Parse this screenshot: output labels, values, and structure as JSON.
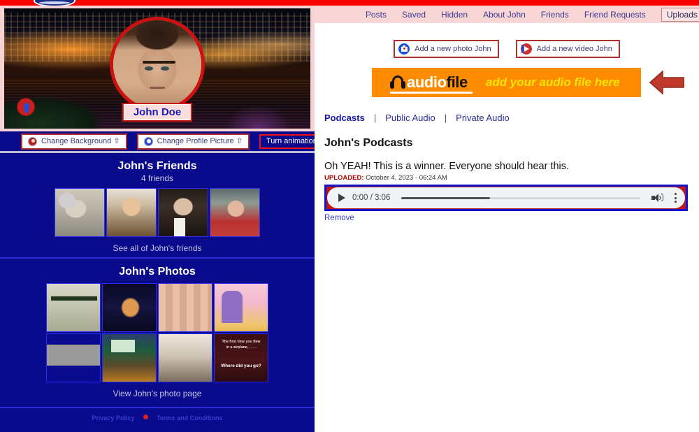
{
  "site": {
    "logo_name": "site-logo"
  },
  "profile": {
    "display_name": "John Doe",
    "cover_alt": "city-nightscape-cover-photo",
    "avatar_alt": "john-doe-profile-photo",
    "buttons": {
      "change_background": "Change Background ⇧",
      "change_profile_picture": "Change Profile Picture ⇧",
      "turn_animation": "Turn animation OFF ⇧"
    }
  },
  "friends": {
    "title": "John's Friends",
    "count_label": "4 friends",
    "see_all": "See all of John's friends",
    "items": [
      {
        "alt": "friend-photo-1"
      },
      {
        "alt": "friend-photo-2"
      },
      {
        "alt": "friend-photo-3"
      },
      {
        "alt": "friend-photo-4"
      }
    ]
  },
  "photos": {
    "title": "John's Photos",
    "view_page": "View John's photo page",
    "items": [
      {
        "alt": "photo-restaurant-storefront"
      },
      {
        "alt": "photo-woman-in-stars"
      },
      {
        "alt": "photo-group-of-friends"
      },
      {
        "alt": "photo-cartoon-child"
      },
      {
        "alt": "photo-black-and-white"
      },
      {
        "alt": "photo-neon-sign"
      },
      {
        "alt": "photo-mall-interior"
      },
      {
        "alt": "photo-airplane-question"
      }
    ],
    "caption_line1": "The first time you flew",
    "caption_line2": "in a airplane, . . . .",
    "caption_line3": "Where did you go?"
  },
  "footer": {
    "privacy": "Privacy Policy",
    "terms": "Terms and Conditions"
  },
  "nav": {
    "items": [
      {
        "label": "Posts"
      },
      {
        "label": "Saved"
      },
      {
        "label": "Hidden"
      },
      {
        "label": "About John"
      },
      {
        "label": "Friends"
      },
      {
        "label": "Friend Requests"
      }
    ],
    "uploads": {
      "label": "Uploads",
      "caret": "▼"
    }
  },
  "add_row": {
    "photo": "Add a new photo John",
    "video": "Add a new video John"
  },
  "audio_banner": {
    "brand_a": "audio",
    "brand_b": "file",
    "cta": "add your audio file here",
    "accent_color": "#ff8c00",
    "cta_color": "#ffe600",
    "arrow_color": "#c0392b"
  },
  "audio_tabs": {
    "items": [
      {
        "label": "Podcasts",
        "active": true
      },
      {
        "label": "Public Audio",
        "active": false
      },
      {
        "label": "Private Audio",
        "active": false
      }
    ],
    "separator": "|"
  },
  "podcast": {
    "heading": "John's Podcasts",
    "description": "Oh YEAH! This is a winner. Everyone should hear this.",
    "uploaded_label": "UPLOADED:",
    "uploaded_value": "October 4, 2023 - 06:24 AM",
    "player": {
      "current_time": "0:00",
      "duration": "3:06",
      "time_display": "0:00 / 3:06",
      "progress_percent": 37
    },
    "remove": "Remove"
  }
}
